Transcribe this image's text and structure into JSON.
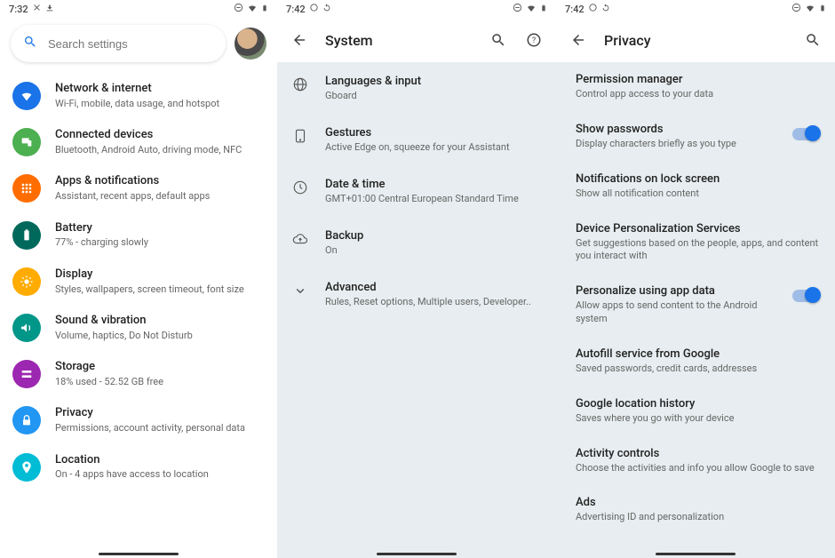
{
  "status": {
    "p0_time": "7:32",
    "p1_time": "7:42",
    "p2_time": "7:42"
  },
  "search": {
    "placeholder": "Search settings"
  },
  "settings": {
    "items": [
      {
        "title": "Network & internet",
        "sub": "Wi-Fi, mobile, data usage, and hotspot",
        "color": "#1a73e8"
      },
      {
        "title": "Connected devices",
        "sub": "Bluetooth, Android Auto, driving mode, NFC",
        "color": "#4caf50"
      },
      {
        "title": "Apps & notifications",
        "sub": "Assistant, recent apps, default apps",
        "color": "#ff6d00"
      },
      {
        "title": "Battery",
        "sub": "77% - charging slowly",
        "color": "#00695c"
      },
      {
        "title": "Display",
        "sub": "Styles, wallpapers, screen timeout, font size",
        "color": "#ffab00"
      },
      {
        "title": "Sound & vibration",
        "sub": "Volume, haptics, Do Not Disturb",
        "color": "#009688"
      },
      {
        "title": "Storage",
        "sub": "18% used - 52.52 GB free",
        "color": "#9c27b0"
      },
      {
        "title": "Privacy",
        "sub": "Permissions, account activity, personal data",
        "color": "#2196f3"
      },
      {
        "title": "Location",
        "sub": "On - 4 apps have access to location",
        "color": "#00bcd4"
      }
    ]
  },
  "system": {
    "title": "System",
    "rows": [
      {
        "title": "Languages & input",
        "sub": "Gboard"
      },
      {
        "title": "Gestures",
        "sub": "Active Edge on, squeeze for your Assistant"
      },
      {
        "title": "Date & time",
        "sub": "GMT+01:00 Central European Standard Time"
      },
      {
        "title": "Backup",
        "sub": "On"
      },
      {
        "title": "Advanced",
        "sub": "Rules, Reset options, Multiple users, Developer.."
      }
    ]
  },
  "privacy": {
    "title": "Privacy",
    "rows": [
      {
        "title": "Permission manager",
        "sub": "Control app access to your data",
        "toggle": false
      },
      {
        "title": "Show passwords",
        "sub": "Display characters briefly as you type",
        "toggle": true
      },
      {
        "title": "Notifications on lock screen",
        "sub": "Show all notification content",
        "toggle": false
      },
      {
        "title": "Device Personalization Services",
        "sub": "Get suggestions based on the people, apps, and content you interact with",
        "toggle": false
      },
      {
        "title": "Personalize using app data",
        "sub": "Allow apps to send content to the Android system",
        "toggle": true
      },
      {
        "title": "Autofill service from Google",
        "sub": "Saved passwords, credit cards, addresses",
        "toggle": false
      },
      {
        "title": "Google location history",
        "sub": "Saves where you go with your device",
        "toggle": false
      },
      {
        "title": "Activity controls",
        "sub": "Choose the activities and info you allow Google to save",
        "toggle": false
      },
      {
        "title": "Ads",
        "sub": "Advertising ID and personalization",
        "toggle": false
      }
    ]
  }
}
